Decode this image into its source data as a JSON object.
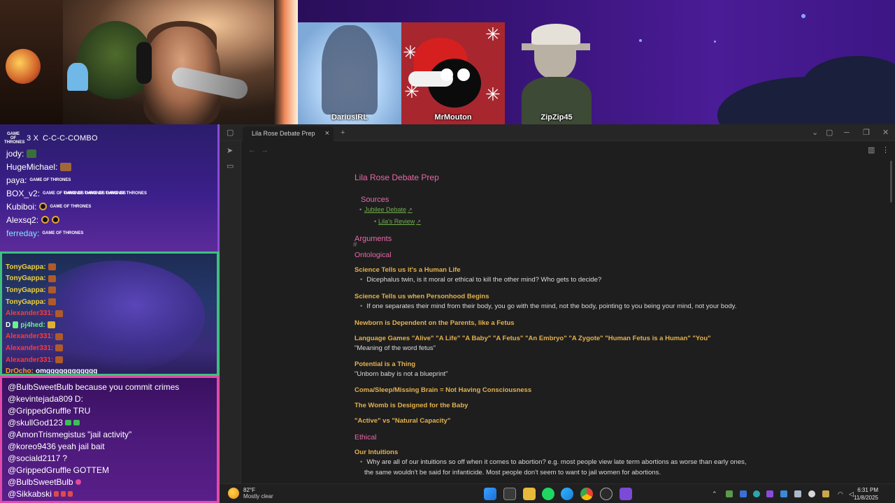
{
  "stream": {
    "friends": [
      {
        "name": "DariusIRL"
      },
      {
        "name": "MrMouton"
      },
      {
        "name": "ZipZip45"
      }
    ],
    "combo": {
      "count": "3 X",
      "text": "C-C-C-COMBO",
      "badge": "GAME OF THRONES"
    },
    "chat_top": [
      {
        "user": "jody:",
        "color": "white"
      },
      {
        "user": "HugeMichael:",
        "color": "white"
      },
      {
        "user": "paya:",
        "color": "white"
      },
      {
        "user": "BOX_v2:",
        "color": "white"
      },
      {
        "user": "Kubiboi:",
        "color": "white"
      },
      {
        "user": "Alexsq2:",
        "color": "white"
      },
      {
        "user": "ferreday:",
        "color": "cyan"
      }
    ],
    "chat_mid": [
      {
        "user": "TonyGappa:",
        "color": "yellow",
        "text": ""
      },
      {
        "user": "TonyGappa:",
        "color": "yellow",
        "text": ""
      },
      {
        "user": "TonyGappa:",
        "color": "yellow",
        "text": ""
      },
      {
        "user": "TonyGappa:",
        "color": "yellow",
        "text": ""
      },
      {
        "user": "Alexander331:",
        "color": "red",
        "text": ""
      },
      {
        "user": "pj4hed:",
        "color": "green",
        "text": "",
        "prefix": "D"
      },
      {
        "user": "Alexander331:",
        "color": "red",
        "text": ""
      },
      {
        "user": "Alexander331:",
        "color": "red",
        "text": ""
      },
      {
        "user": "Alexander331:",
        "color": "red",
        "text": ""
      },
      {
        "user": "DrOcho:",
        "color": "orange",
        "text": "omgggggggggggg"
      }
    ],
    "chat_bottom": [
      {
        "user": "@BulbSweetBulb",
        "text": "because you commit crimes"
      },
      {
        "user": "@kevintejada809",
        "text": "D:"
      },
      {
        "user": "@GrippedGruffle",
        "text": "TRU"
      },
      {
        "user": "@skullGod123",
        "text": ""
      },
      {
        "user": "@AmonTrismegistus",
        "text": "\"jail activity\""
      },
      {
        "user": "@koreo9436",
        "text": "yeah jail bait"
      },
      {
        "user": "@sociald2117",
        "text": "?"
      },
      {
        "user": "@GrippedGruffle",
        "text": "GOTTEM"
      },
      {
        "user": "@BulbSweetBulb",
        "text": ""
      },
      {
        "user": "@Sikkabski",
        "text": ""
      }
    ]
  },
  "app": {
    "tab_title": "Lila Rose Debate Prep",
    "close_glyph": "×",
    "new_tab_glyph": "+",
    "window_controls": {
      "minimize": "─",
      "maximize": "❐",
      "close": "✕"
    },
    "nav": {
      "back": "←",
      "forward": "→"
    }
  },
  "doc": {
    "title": "Lila Rose Debate Prep",
    "hash": "#",
    "sources_heading": "Sources",
    "links": [
      {
        "text": "Jubilee Debate",
        "ext": "↗"
      },
      {
        "text": "Lila's Review",
        "ext": "↗"
      }
    ],
    "arguments_heading": "Arguments",
    "ontological_heading": "Ontological",
    "sections": [
      {
        "heading": "Science Tells us it's a Human Life",
        "bullet": "Dicephalus twin, is it moral or ethical to kill the other mind? Who gets to decide?"
      },
      {
        "heading": "Science Tells us when Personhood Begins",
        "bullet": "If one separates their mind from their body, you go with the mind, not the body, pointing to you being your mind, not your body."
      },
      {
        "heading": "Newborn is Dependent on the Parents, like a Fetus"
      },
      {
        "heading": "Language Games \"Alive\" \"A Life\" \"A Baby\" \"A Fetus\" \"An Embryo\" \"A Zygote\" \"Human Fetus is a Human\" \"You\"",
        "plain": "\"Meaning of the word fetus\""
      },
      {
        "heading": "Potential is a Thing",
        "plain": "\"Unborn baby is not a blueprint\""
      },
      {
        "heading": "Coma/Sleep/Missing Brain = Not Having Consciousness"
      },
      {
        "heading": "The Womb is Designed for the Baby"
      },
      {
        "heading": "\"Active\" vs \"Natural Capacity\""
      }
    ],
    "ethical_heading": "Ethical",
    "intuitions": {
      "heading": "Our Intuitions",
      "bullet": "Why are all of our intuitions so off when it comes to abortion? e.g. most people view late term abortions as worse than early ones,",
      "continuation": "the same wouldn't be said for infanticide. Most people don't seem to want to jail women for abortions."
    }
  },
  "taskbar": {
    "weather_temp": "82°F",
    "weather_desc": "Mostly clear",
    "time": "6:31 PM",
    "date": "11/8/2025"
  },
  "colors": {
    "heading_pink": "#e96aa8",
    "heading_gold": "#e4b14e",
    "link_green": "#6fae4a"
  }
}
